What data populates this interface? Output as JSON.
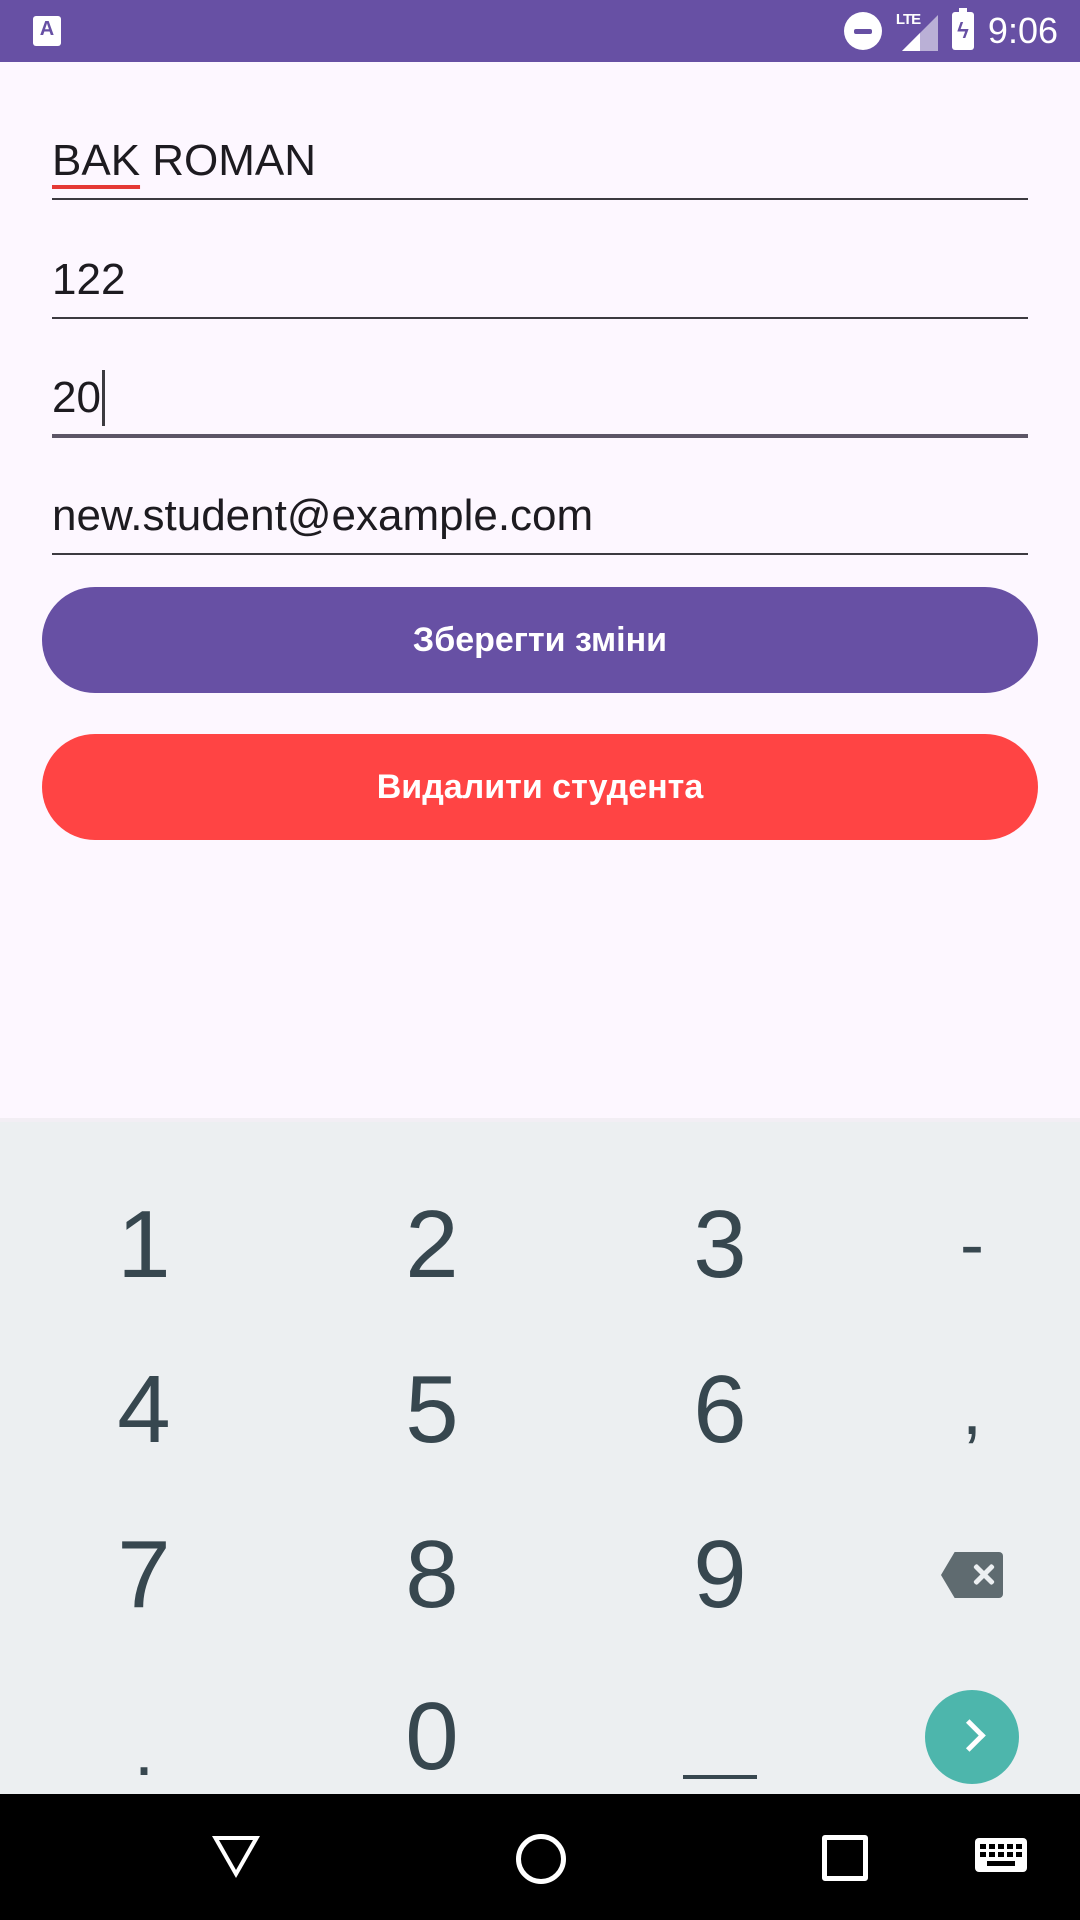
{
  "status_bar": {
    "app_badge": "A",
    "network": "LTE",
    "time": "9:06",
    "color": "#6750a4"
  },
  "form": {
    "name": "BAK ROMAN",
    "group": "122",
    "age": "20",
    "email": "new.student@example.com"
  },
  "buttons": {
    "save_label": "Зберегти зміни",
    "delete_label": "Видалити студента",
    "save_color": "#6750a4",
    "delete_color": "#ff4444"
  },
  "keyboard": {
    "row1": [
      "1",
      "2",
      "3",
      "-"
    ],
    "row2": [
      "4",
      "5",
      "6",
      ","
    ],
    "row3": [
      "7",
      "8",
      "9"
    ],
    "row4": [
      ".",
      "0"
    ]
  }
}
